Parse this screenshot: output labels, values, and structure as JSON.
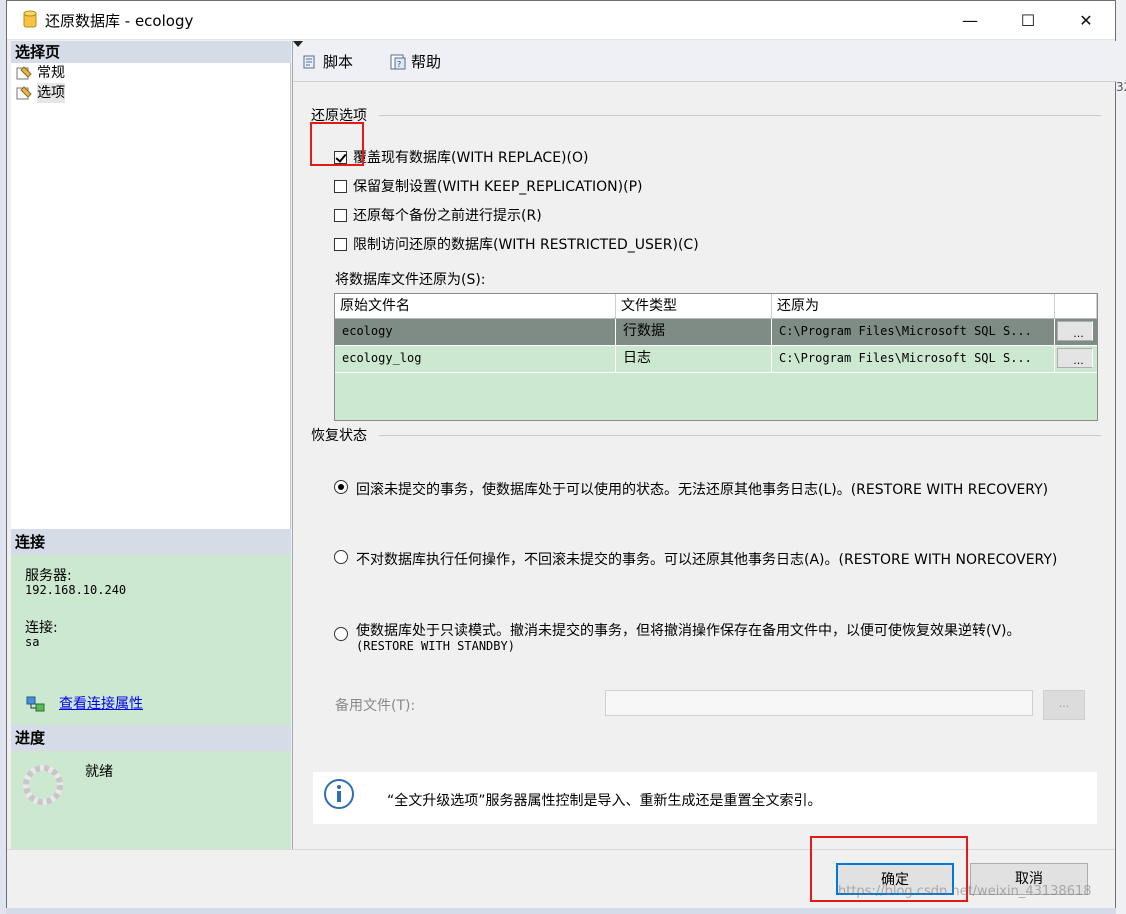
{
  "window": {
    "title": "还原数据库 - ecology",
    "minimize_label": "—",
    "maximize_label": "☐",
    "close_label": "✕"
  },
  "left_pane": {
    "select_page_header": "选择页",
    "pages": [
      {
        "label": "常规",
        "selected": false
      },
      {
        "label": "选项",
        "selected": true
      }
    ],
    "connection_header": "连接",
    "server_label": "服务器:",
    "server_value": "192.168.10.240",
    "connection_label": "连接:",
    "connection_value": "sa",
    "view_connection_link": "查看连接属性",
    "progress_header": "进度",
    "progress_status": "就绪"
  },
  "toolbar": {
    "script_label": "脚本",
    "help_label": "帮助"
  },
  "restore_options": {
    "group_title": "还原选项",
    "checkboxes": [
      {
        "label": "覆盖现有数据库(WITH REPLACE)(O)",
        "checked": true
      },
      {
        "label": "保留复制设置(WITH KEEP_REPLICATION)(P)",
        "checked": false
      },
      {
        "label": "还原每个备份之前进行提示(R)",
        "checked": false
      },
      {
        "label": "限制访问还原的数据库(WITH RESTRICTED_USER)(C)",
        "checked": false
      }
    ],
    "files_label": "将数据库文件还原为(S):",
    "files_columns": [
      "原始文件名",
      "文件类型",
      "还原为"
    ],
    "files_rows": [
      {
        "original": "ecology",
        "type": "行数据",
        "restore_as": "C:\\Program Files\\Microsoft SQL S...",
        "button": "..."
      },
      {
        "original": "ecology_log",
        "type": "日志",
        "restore_as": "C:\\Program Files\\Microsoft SQL S...",
        "button": "..."
      }
    ]
  },
  "recovery_state": {
    "group_title": "恢复状态",
    "options": [
      {
        "label": "回滚未提交的事务，使数据库处于可以使用的状态。无法还原其他事务日志(L)。(RESTORE WITH RECOVERY)",
        "sub": "",
        "selected": true
      },
      {
        "label": "不对数据库执行任何操作，不回滚未提交的事务。可以还原其他事务日志(A)。(RESTORE WITH NORECOVERY)",
        "sub": "",
        "selected": false
      },
      {
        "label": "使数据库处于只读模式。撤消未提交的事务，但将撤消操作保存在备用文件中，以便可使恢复效果逆转(V)。",
        "sub": "(RESTORE WITH STANDBY)",
        "selected": false
      }
    ],
    "standby_label": "备用文件(T):",
    "standby_value": "",
    "standby_button": "..."
  },
  "info": {
    "text": "“全文升级选项”服务器属性控制是导入、重新生成还是重置全文索引。"
  },
  "buttons": {
    "ok": "确定",
    "cancel": "取消"
  },
  "watermark": "https://blog.csdn.net/weixin_43138618",
  "background_fragment": "32",
  "colors": {
    "panel_green": "#cde8d0",
    "selected_row": "#7f8c85",
    "highlight_red": "#e21a1a",
    "ok_border": "#0078d7"
  }
}
